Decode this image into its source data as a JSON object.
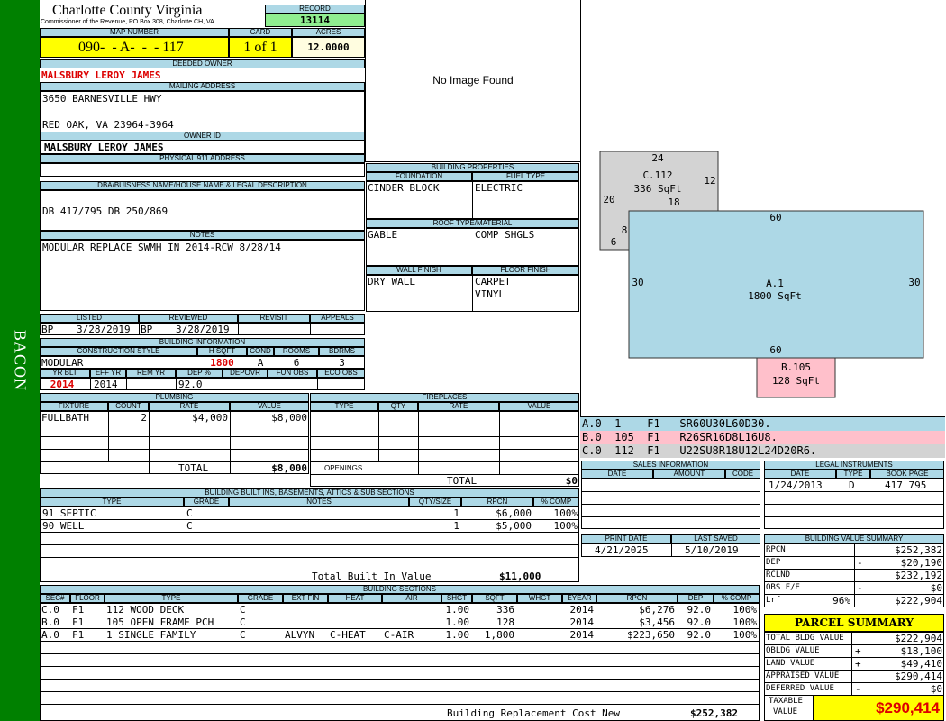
{
  "side_label": "BACON",
  "header": {
    "county": "Charlotte County Virginia",
    "subtitle": "Commissioner of the Revenue, PO Box 308, Charlotte CH, VA",
    "record_label": "RECORD",
    "record": "13114",
    "map_label": "MAP NUMBER",
    "map": "090-  - A-  -  - 117",
    "card_label": "CARD",
    "card": "1 of 1",
    "acres_label": "ACRES",
    "acres": "12.0000"
  },
  "owner": {
    "deeded_label": "DEEDED OWNER",
    "deeded": "MALSBURY LEROY JAMES",
    "mailing_label": "MAILING ADDRESS",
    "addr1": "3650 BARNESVILLE HWY",
    "addr2": "RED OAK, VA 23964-3964",
    "ownerid_label": "OWNER ID",
    "ownerid": "MALSBURY LEROY JAMES",
    "phys_label": "PHYSICAL 911 ADDRESS",
    "dba_label": "DBA/BUISNESS NAME/HOUSE NAME & LEGAL DESCRIPTION",
    "dba": "DB 417/795 DB 250/869",
    "notes_label": "NOTES",
    "notes": "MODULAR REPLACE SWMH IN 2014-RCW 8/28/14"
  },
  "image": {
    "text": "No Image Found"
  },
  "props": {
    "title": "BUILDING PROPERTIES",
    "foundation_label": "FOUNDATION",
    "foundation": "CINDER BLOCK",
    "fuel_label": "FUEL TYPE",
    "fuel": "ELECTRIC",
    "roof_label": "ROOF TYPE/MATERIAL",
    "roof1": "GABLE",
    "roof2": "COMP SHGLS",
    "wall_label": "WALL FINISH",
    "wall": "DRY WALL",
    "floor_label": "FLOOR FINISH",
    "floor1": "CARPET",
    "floor2": "VINYL"
  },
  "listing": {
    "listed_label": "LISTED",
    "reviewed_label": "REVIEWED",
    "revisit_label": "REVISIT",
    "appeals_label": "APPEALS",
    "listed_by": "BP",
    "listed_date": "3/28/2019",
    "reviewed_by": "BP",
    "reviewed_date": "3/28/2019"
  },
  "building": {
    "title": "BUILDING INFORMATION",
    "style_label": "CONSTRUCTION STYLE",
    "hsqft_label": "H SQFT",
    "cond_label": "COND",
    "rooms_label": "ROOMS",
    "bdrms_label": "BDRMS",
    "style": "MODULAR",
    "hsqft": "1800",
    "cond": "A",
    "rooms": "6",
    "bdrms": "3",
    "yrblt_label": "YR BLT",
    "effyr_label": "EFF YR",
    "remyr_label": "REM YR",
    "dep_label": "DEP %",
    "depovr_label": "DEPOVR",
    "funobs_label": "FUN OBS",
    "ecoobs_label": "ECO OBS",
    "yrblt": "2014",
    "effyr": "2014",
    "dep": "92.0"
  },
  "plumbing": {
    "title": "PLUMBING",
    "h_fixture": "FIXTURE",
    "h_count": "COUNT",
    "h_rate": "RATE",
    "h_value": "VALUE",
    "fixture": "FULLBATH",
    "count": "2",
    "rate": "$4,000",
    "value": "$8,000",
    "total_label": "TOTAL",
    "total": "$8,000"
  },
  "fireplaces": {
    "title": "FIREPLACES",
    "h_type": "TYPE",
    "h_qty": "QTY",
    "h_rate": "RATE",
    "h_value": "VALUE",
    "openings_label": "OPENINGS",
    "total_label": "TOTAL",
    "total": "$0"
  },
  "builtins": {
    "title": "BUILDING BUILT INS, BASEMENTS, ATTICS & SUB SECTIONS",
    "h_type": "TYPE",
    "h_grade": "GRADE",
    "h_notes": "NOTES",
    "h_qty": "QTY/SIZE",
    "h_rpcn": "RPCN",
    "h_comp": "% COMP",
    "rows": [
      {
        "type": "91 SEPTIC",
        "grade": "C",
        "qty": "1",
        "rpcn": "$6,000",
        "comp": "100%"
      },
      {
        "type": "90 WELL",
        "grade": "C",
        "qty": "1",
        "rpcn": "$5,000",
        "comp": "100%"
      }
    ],
    "total_label": "Total Built In Value",
    "total": "$11,000"
  },
  "sections": {
    "title": "BUILDING SECTIONS",
    "headers": [
      "SEC#",
      "FLOOR",
      "TYPE",
      "GRADE",
      "EXT FIN",
      "HEAT",
      "AIR",
      "SHGT",
      "SQFT",
      "WHGT",
      "EYEAR",
      "RPCN",
      "DEP",
      "% COMP"
    ],
    "rows": [
      {
        "sec": "C.0",
        "floor": "F1",
        "type": "112 WOOD DECK",
        "grade": "C",
        "extfin": "",
        "heat": "",
        "air": "",
        "shgt": "1.00",
        "sqft": "336",
        "whgt": "",
        "eyear": "2014",
        "rpcn": "$6,276",
        "dep": "92.0",
        "comp": "100%"
      },
      {
        "sec": "B.0",
        "floor": "F1",
        "type": "105 OPEN FRAME PCH",
        "grade": "C",
        "extfin": "",
        "heat": "",
        "air": "",
        "shgt": "1.00",
        "sqft": "128",
        "whgt": "",
        "eyear": "2014",
        "rpcn": "$3,456",
        "dep": "92.0",
        "comp": "100%"
      },
      {
        "sec": "A.0",
        "floor": "F1",
        "type": "1 SINGLE FAMILY",
        "grade": "C",
        "extfin": "ALVYN",
        "heat": "C-HEAT",
        "air": "C-AIR",
        "shgt": "1.00",
        "sqft": "1,800",
        "whgt": "",
        "eyear": "2014",
        "rpcn": "$223,650",
        "dep": "92.0",
        "comp": "100%"
      }
    ],
    "footer_label": "Building Replacement Cost New",
    "footer": "$252,382"
  },
  "sketch": {
    "c_label": "C.112",
    "c_area": "336 SqFt",
    "c_top": "24",
    "c_right": "12",
    "c_left": "20",
    "c_inner": "18",
    "c_lower_left": "6",
    "c_lower_right": "8",
    "a_label": "A.1",
    "a_area": "1800 SqFt",
    "a_top": "60",
    "a_bottom": "60",
    "a_left": "30",
    "a_right": "30",
    "b_label": "B.105",
    "b_area": "128 SqFt",
    "color_a": "#add8e6",
    "color_b": "#ffc0cb",
    "color_c": "#d3d3d3"
  },
  "vectors": [
    {
      "sec": "A.0",
      "n": "1",
      "fl": "F1",
      "code": "SR60U30L60D30."
    },
    {
      "sec": "B.0",
      "n": "105",
      "fl": "F1",
      "code": "R26SR16D8L16U8."
    },
    {
      "sec": "C.0",
      "n": "112",
      "fl": "F1",
      "code": "U22SU8R18U12L24D20R6."
    }
  ],
  "sales": {
    "title": "SALES INFORMATION",
    "h_date": "DATE",
    "h_amount": "AMOUNT",
    "h_code": "CODE"
  },
  "legal": {
    "title": "LEGAL INSTRUMENTS",
    "h_date": "DATE",
    "h_type": "TYPE",
    "h_book": "BOOK PAGE",
    "date": "1/24/2013",
    "type": "D",
    "book": "417 795"
  },
  "print": {
    "print_label": "PRINT DATE",
    "saved_label": "LAST SAVED",
    "print_date": "4/21/2025",
    "saved_date": "5/10/2019"
  },
  "value_summary": {
    "title": "BUILDING VALUE SUMMARY",
    "rpcn_label": "RPCN",
    "rpcn": "$252,382",
    "dep_label": "DEP",
    "dep_sign": "-",
    "dep": "$20,190",
    "rclnd_label": "RCLND",
    "rclnd": "$232,192",
    "obs_label": "OBS F/E",
    "obs_sign": "-",
    "obs": "$0",
    "lrf_label": "Lrf",
    "lrf_pct": "96%",
    "lrf": "$222,904"
  },
  "parcel": {
    "title": "PARCEL SUMMARY",
    "bldg_label": "TOTAL BLDG VALUE",
    "bldg": "$222,904",
    "obldg_label": "OBLDG VALUE",
    "obldg_sign": "+",
    "obldg": "$18,100",
    "land_label": "LAND VALUE",
    "land_sign": "+",
    "land": "$49,410",
    "appr_label": "APPRAISED VALUE",
    "appr": "$290,414",
    "def_label": "DEFERRED VALUE",
    "def_sign": "-",
    "def": "$0",
    "tax_label1": "TAXABLE",
    "tax_label2": "VALUE",
    "tax": "$290,414"
  }
}
